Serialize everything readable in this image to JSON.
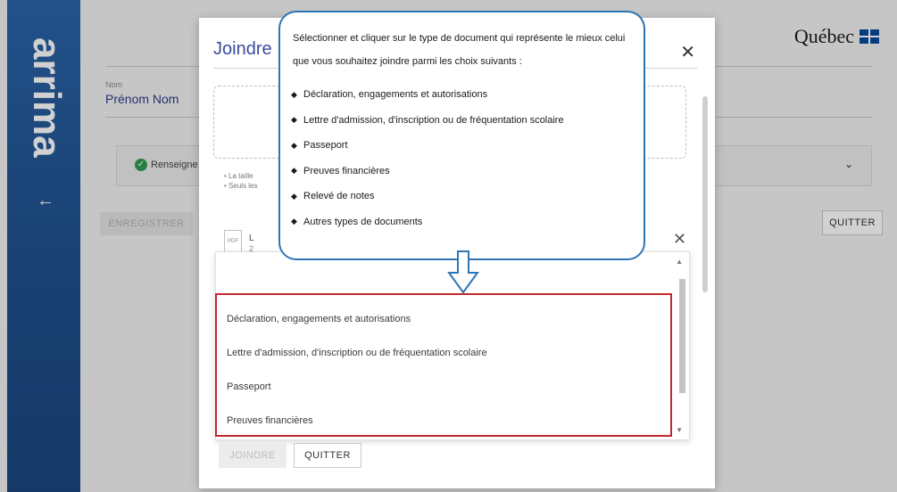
{
  "sidebar": {
    "brand": "arrima",
    "back_icon": "arrow-left-icon"
  },
  "page": {
    "logo_text": "Québec",
    "name_label": "Nom",
    "name_value": "Prénom Nom",
    "status_text": "Renseigne",
    "save_button": "ENREGISTRER",
    "quit_button": "QUITTER"
  },
  "modal": {
    "title": "Joindre",
    "close_icon": "close-icon",
    "hints": [
      "La taille",
      "Seuls les"
    ],
    "file_name": "L",
    "file_date": "2",
    "pdf_label": "PDF",
    "join_button": "JOINDRE",
    "quit_button": "QUITTER"
  },
  "dropdown": {
    "items": [
      "Déclaration, engagements et autorisations",
      "Lettre d'admission, d'inscription ou de fréquentation scolaire",
      "Passeport",
      "Preuves financières"
    ]
  },
  "callout": {
    "intro": "Sélectionner et cliquer sur le type de document qui représente le mieux celui que vous souhaitez joindre parmi les choix suivants :",
    "items": [
      "Déclaration, engagements et autorisations",
      "Lettre d'admission, d'inscription ou de fréquentation scolaire",
      "Passeport",
      "Preuves financières",
      "Relevé de notes",
      "Autres types de documents"
    ]
  },
  "colors": {
    "sidebar_blue": "#1f4f8c",
    "accent_blue": "#2e75b6",
    "highlight_red": "#c0282d",
    "title_blue": "#3a4aa0"
  }
}
